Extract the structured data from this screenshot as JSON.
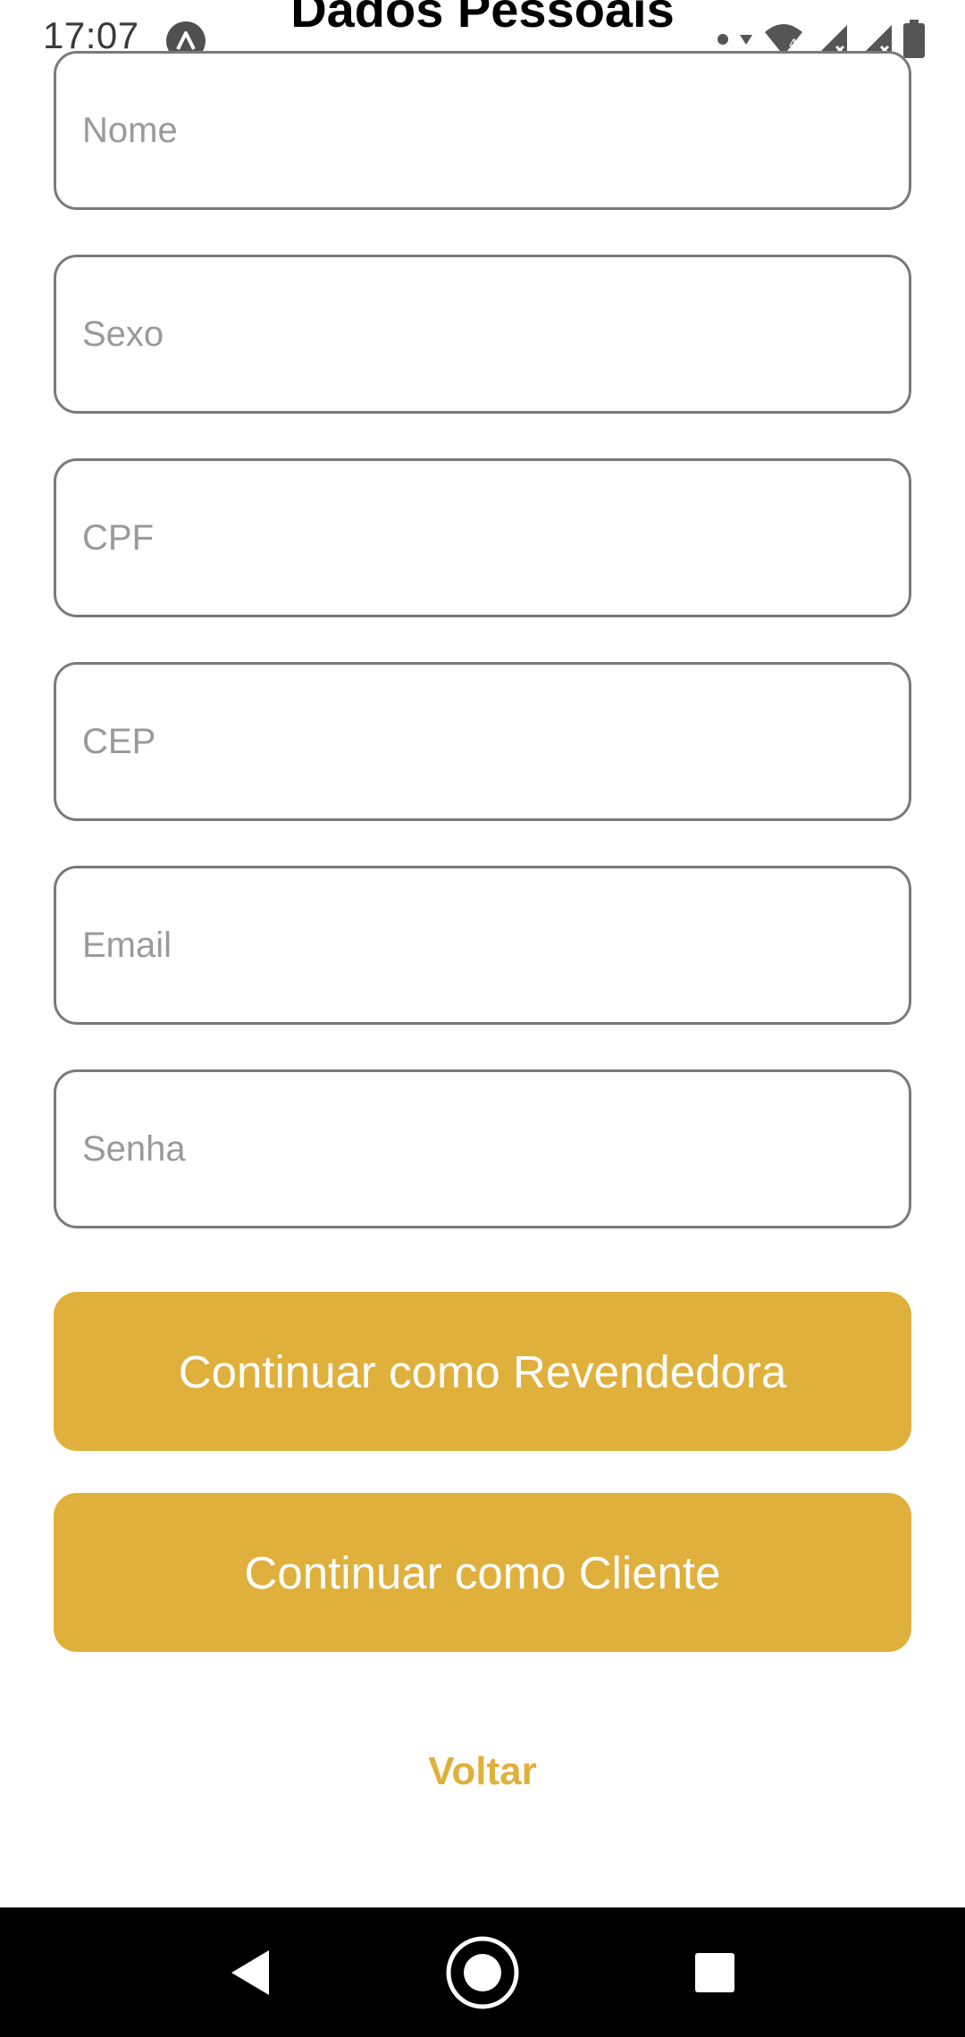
{
  "status_bar": {
    "time": "17:07",
    "icons": [
      "app-badge-icon",
      "notification-dot-icon",
      "data-arrow-icon",
      "wifi-icon",
      "signal-icon",
      "signal-icon",
      "battery-icon"
    ]
  },
  "header": {
    "title": "Dados Pessoais"
  },
  "form": {
    "fields": [
      {
        "placeholder": "Nome",
        "value": ""
      },
      {
        "placeholder": "Sexo",
        "value": ""
      },
      {
        "placeholder": "CPF",
        "value": ""
      },
      {
        "placeholder": "CEP",
        "value": ""
      },
      {
        "placeholder": "Email",
        "value": ""
      },
      {
        "placeholder": "Senha",
        "value": ""
      }
    ]
  },
  "actions": {
    "reseller_label": "Continuar como Revendedora",
    "client_label": "Continuar como Cliente",
    "back_label": "Voltar"
  },
  "nav_bar": {
    "icons": [
      "back-icon",
      "home-icon",
      "recents-icon"
    ]
  },
  "colors": {
    "accent": "#e0b03c",
    "field_border": "#7a7a7a",
    "placeholder": "#9a9a9a"
  }
}
